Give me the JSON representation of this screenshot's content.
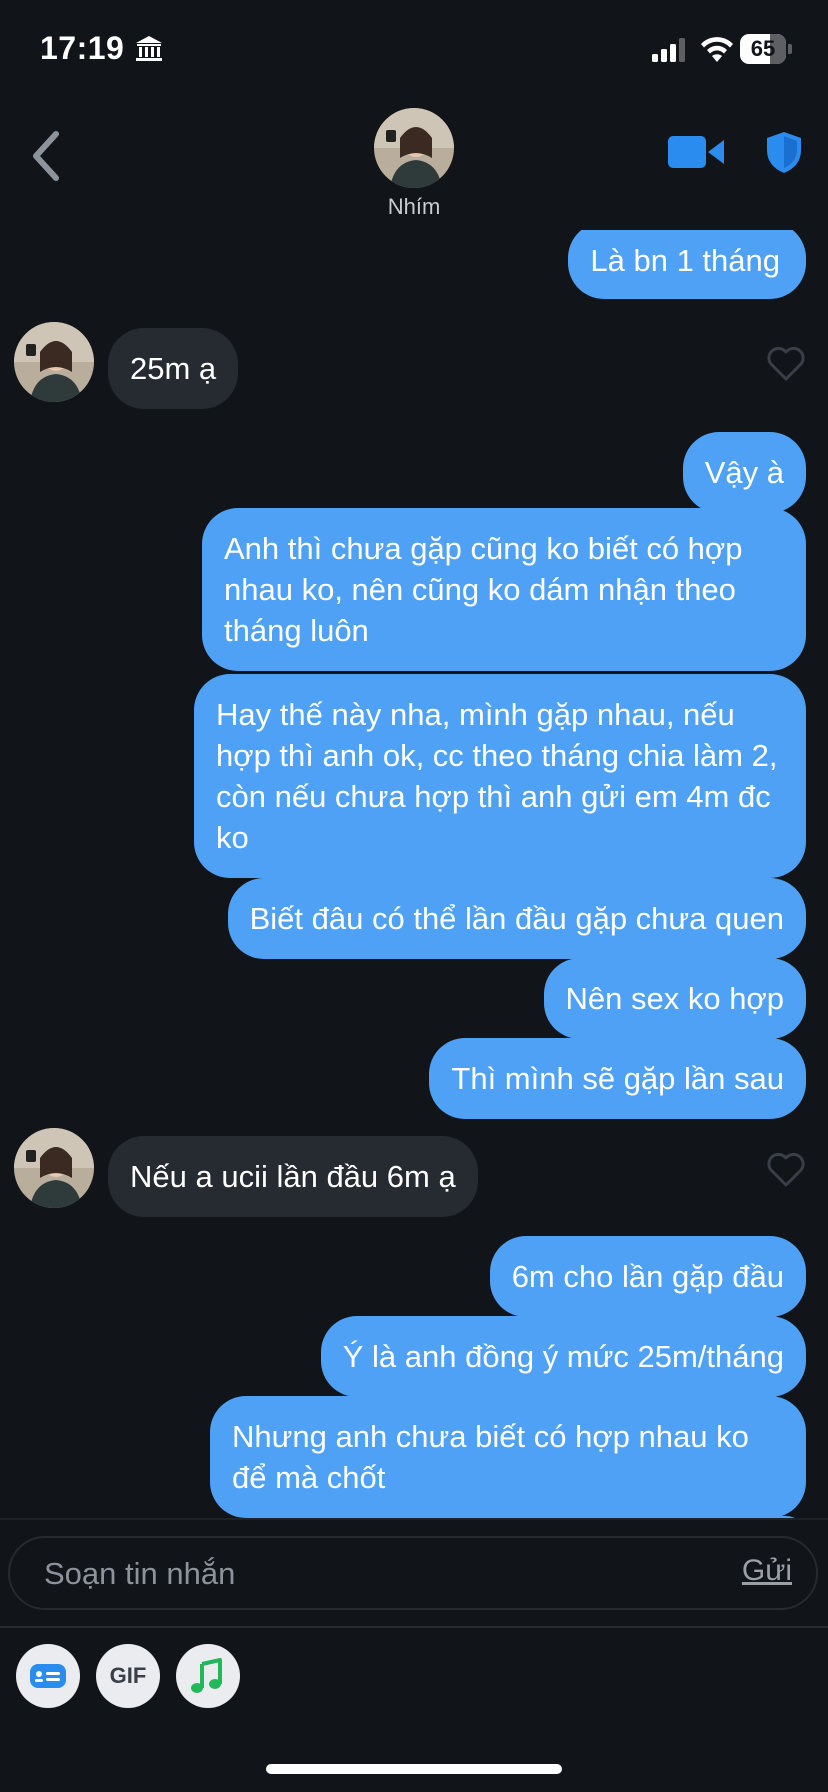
{
  "status_bar": {
    "time": "17:19",
    "battery": "65",
    "battery_level_percent": 65,
    "icons": [
      "bank-icon",
      "signal-icon",
      "wifi-icon",
      "battery-icon"
    ]
  },
  "header": {
    "contact_name": "Nhím",
    "icons": [
      "back-chevron-icon",
      "video-call-icon",
      "shield-icon"
    ],
    "accent_color": "#2b8cf0"
  },
  "messages": [
    {
      "side": "out",
      "text": "Là bn 1 tháng"
    },
    {
      "side": "in",
      "text": "25m ạ"
    },
    {
      "side": "out",
      "text": "Vậy à"
    },
    {
      "side": "out",
      "text": "Anh thì chưa gặp cũng ko biết có hợp nhau ko, nên cũng ko dám nhận theo tháng luôn"
    },
    {
      "side": "out",
      "text": "Hay thế này nha, mình gặp nhau, nếu hợp thì anh ok, cc theo tháng chia làm 2, còn nếu chưa hợp thì anh gửi em 4m đc ko"
    },
    {
      "side": "out",
      "text": "Biết đâu có thể lần đầu gặp chưa quen"
    },
    {
      "side": "out",
      "text": "Nên sex ko hợp"
    },
    {
      "side": "out",
      "text": "Thì mình sẽ gặp lần sau"
    },
    {
      "side": "in",
      "text": "Nếu a ucii lần đầu 6m ạ"
    },
    {
      "side": "out",
      "text": "6m cho lần gặp đầu"
    },
    {
      "side": "out",
      "text": "Ý là anh đồng ý mức 25m/tháng"
    },
    {
      "side": "out",
      "text": "Nhưng anh chưa biết có hợp nhau ko để mà chốt"
    }
  ],
  "composer": {
    "placeholder": "Soạn tin nhắn",
    "send_label": "Gửi"
  },
  "tools": {
    "gif_label": "GIF",
    "icons": [
      "contact-card-icon",
      "gif-icon",
      "music-icon"
    ]
  },
  "colors": {
    "background": "#111419",
    "outgoing_bubble": "#4fa1f5",
    "incoming_bubble": "#262a31"
  }
}
